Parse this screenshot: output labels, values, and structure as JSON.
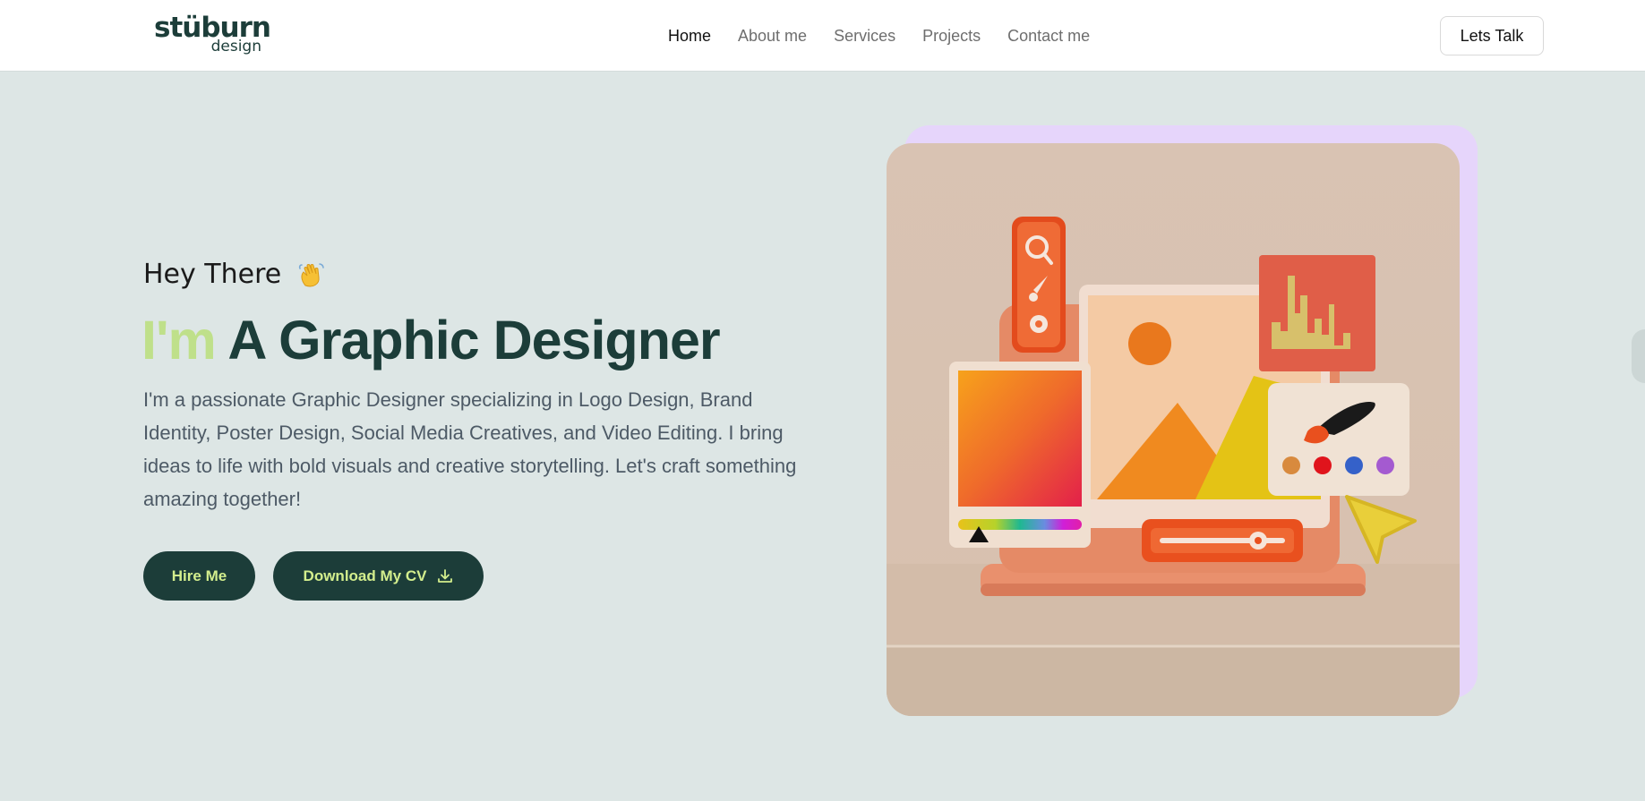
{
  "brand": {
    "name": "stüburn",
    "subtitle": "design"
  },
  "nav": {
    "items": [
      {
        "label": "Home",
        "active": true
      },
      {
        "label": "About me",
        "active": false
      },
      {
        "label": "Services",
        "active": false
      },
      {
        "label": "Projects",
        "active": false
      },
      {
        "label": "Contact me",
        "active": false
      }
    ],
    "cta_label": "Lets Talk"
  },
  "hero": {
    "greeting": "Hey There",
    "greeting_icon": "waving-hand-icon",
    "headline_accent": "I'm",
    "headline_main": "A Graphic Designer",
    "description": "I'm a passionate Graphic Designer specializing in Logo Design, Brand Identity, Poster Design, Social Media Creatives, and Video Editing. I bring ideas to life with bold visuals and creative storytelling. Let's craft something amazing together!",
    "buttons": {
      "hire_label": "Hire Me",
      "cv_label": "Download My CV",
      "cv_icon": "download-icon"
    },
    "image_icon": "design-workspace-illustration"
  },
  "colors": {
    "page_bg": "#dde6e5",
    "primary": "#1c3d39",
    "accent": "#bfe08a",
    "button_text": "#d3ee8d",
    "image_backdrop": "#e6d5fb"
  }
}
